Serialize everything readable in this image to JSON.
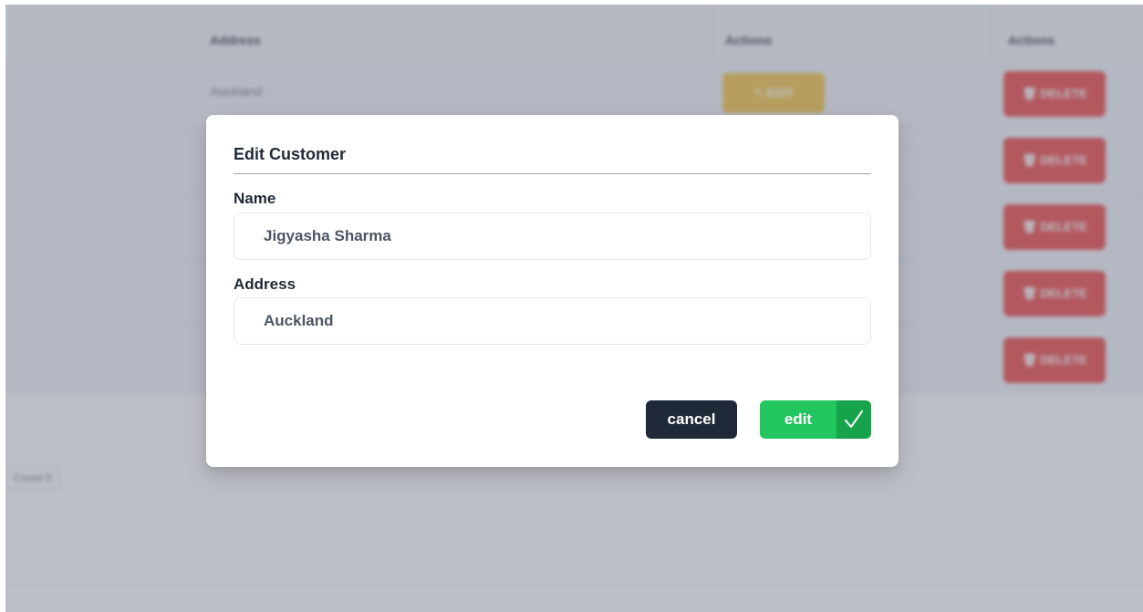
{
  "table": {
    "headers": [
      "Address",
      "Actions",
      "Actions"
    ],
    "rows": [
      {
        "address": "Auckland",
        "edit_label": "✎ EDIT",
        "delete_label": "🗑 DELETE"
      },
      {
        "address": "",
        "edit_label": "",
        "delete_label": "🗑 DELETE"
      },
      {
        "address": "",
        "edit_label": "",
        "delete_label": "🗑 DELETE"
      },
      {
        "address": "",
        "edit_label": "",
        "delete_label": "🗑 DELETE"
      },
      {
        "address": "",
        "edit_label": "",
        "delete_label": "🗑 DELETE"
      }
    ],
    "pager_label": "Count 5"
  },
  "modal": {
    "title": "Edit Customer",
    "fields": [
      {
        "label": "Name",
        "value": "Jigyasha Sharma"
      },
      {
        "label": "Address",
        "value": "Auckland"
      }
    ],
    "cancel_label": "cancel",
    "edit_label": "edit",
    "edit_icon": "checkmark-icon"
  },
  "colors": {
    "edit_button": "#22c55e",
    "edit_button_icon_bg": "#16a34a",
    "cancel_button": "#1f2937",
    "row_edit_button": "#f5c542",
    "row_delete_button": "#ef4444"
  }
}
